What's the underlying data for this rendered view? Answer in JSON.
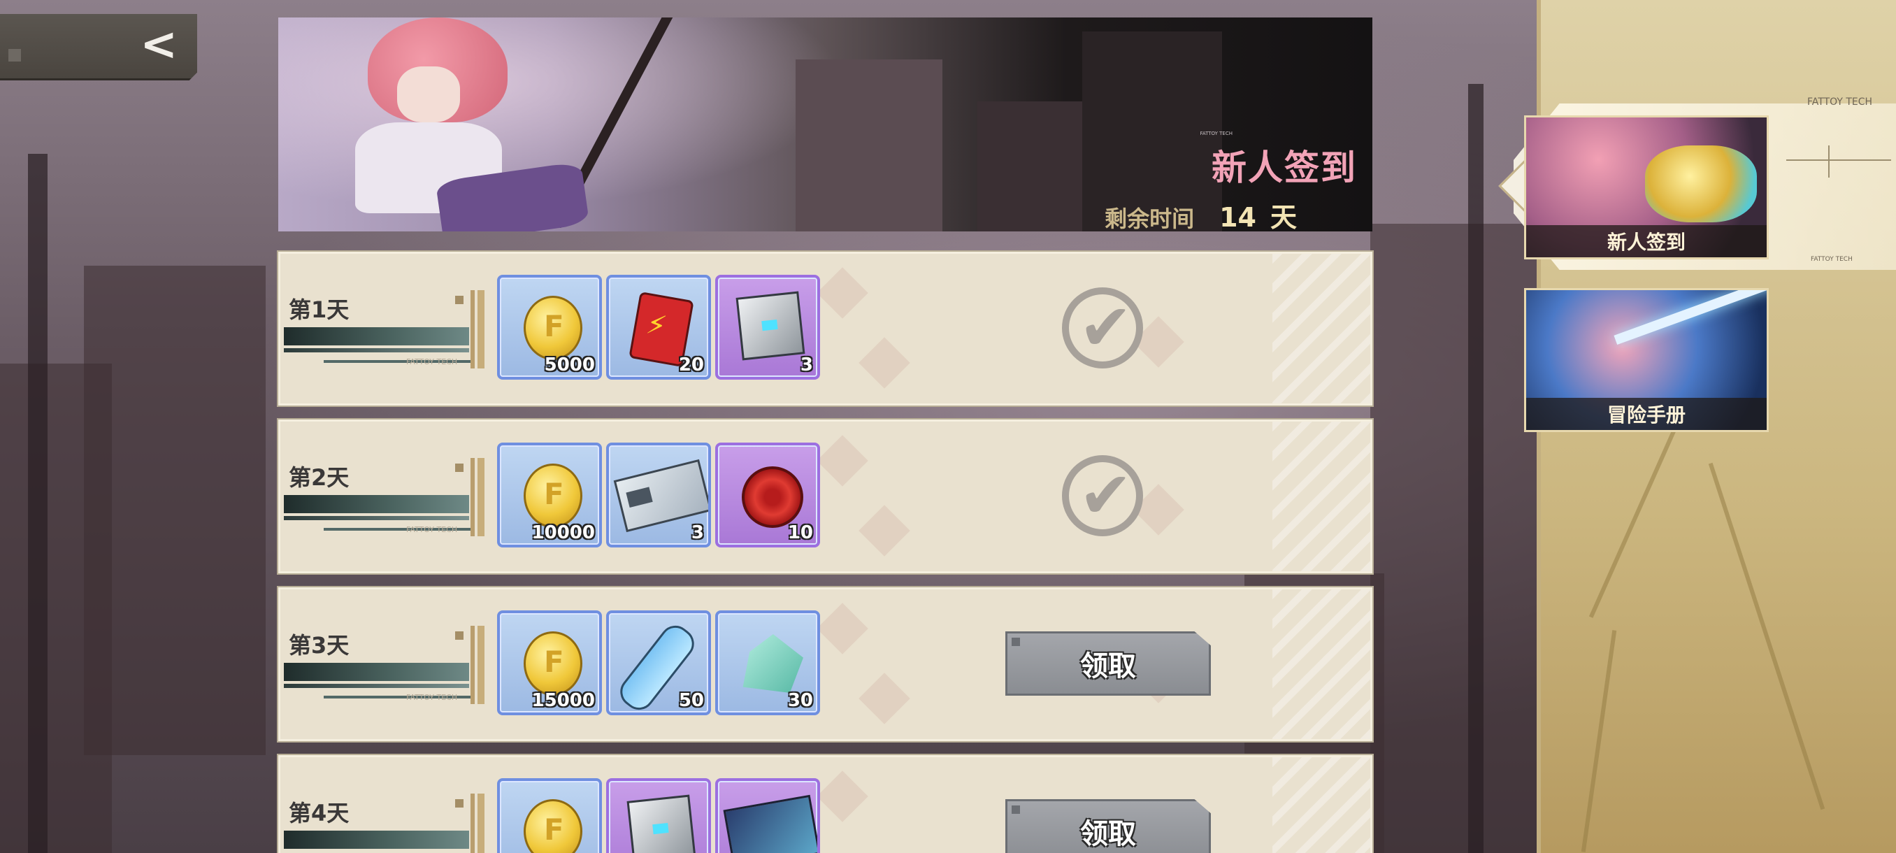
{
  "nav": {
    "back_icon": "chevron-left-icon"
  },
  "banner": {
    "title": "新人签到",
    "remaining_label": "剩余时间",
    "remaining_days": "14",
    "remaining_unit": "天",
    "brand_small": "FATTOY TECH"
  },
  "days": [
    {
      "label": "第1天",
      "items": [
        {
          "icon": "gold-coin-icon",
          "count": "5000",
          "rarity": "blue"
        },
        {
          "icon": "fuel-can-icon",
          "count": "20",
          "rarity": "blue"
        },
        {
          "icon": "supply-cube-icon",
          "count": "3",
          "rarity": "purple"
        }
      ],
      "status": "claimed"
    },
    {
      "label": "第2天",
      "items": [
        {
          "icon": "gold-coin-icon",
          "count": "10000",
          "rarity": "blue"
        },
        {
          "icon": "ticket-icon",
          "count": "3",
          "rarity": "blue"
        },
        {
          "icon": "red-gear-icon",
          "count": "10",
          "rarity": "purple"
        }
      ],
      "status": "claimed"
    },
    {
      "label": "第3天",
      "items": [
        {
          "icon": "gold-coin-icon",
          "count": "15000",
          "rarity": "blue"
        },
        {
          "icon": "test-tube-icon",
          "count": "50",
          "rarity": "blue"
        },
        {
          "icon": "crystal-icon",
          "count": "30",
          "rarity": "blue"
        }
      ],
      "status": "claimable",
      "claim_label": "领取"
    },
    {
      "label": "第4天",
      "items": [
        {
          "icon": "gold-coin-icon",
          "count": "",
          "rarity": "blue"
        },
        {
          "icon": "supply-cube-icon",
          "count": "",
          "rarity": "purple"
        },
        {
          "icon": "data-card-icon",
          "count": "",
          "rarity": "purple"
        }
      ],
      "status": "claimable",
      "claim_label": "领取"
    }
  ],
  "row_brand": "FATTOY TECH",
  "sidebar": {
    "brand": "FATTOY TECH",
    "tabs": [
      {
        "label": "新人签到",
        "selected": true
      },
      {
        "label": "冒险手册",
        "selected": false
      }
    ]
  },
  "colors": {
    "accent_pink": "#f2a3b7",
    "panel_gold": "#cbb67f",
    "card_blue": "#6f8fe0",
    "card_purple": "#9c6fe0"
  }
}
